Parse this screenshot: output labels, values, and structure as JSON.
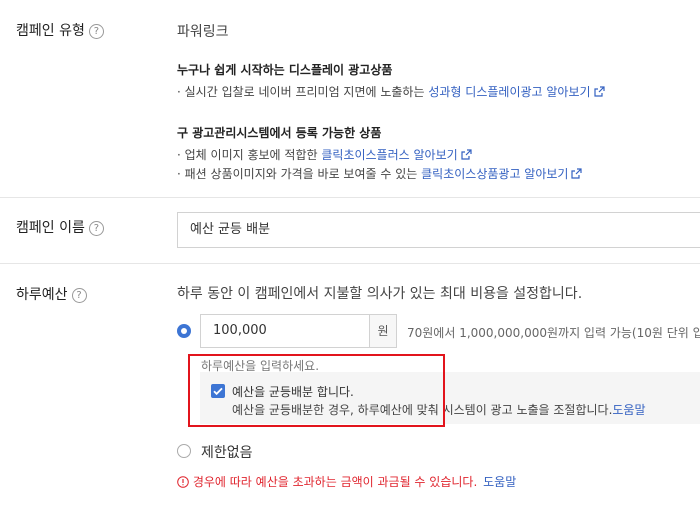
{
  "campaign_type": {
    "label": "캠페인 유형",
    "value": "파워링크",
    "section1_title": "누구나 쉽게 시작하는 디스플레이 광고상품",
    "section1_item_text": "실시간 입찰로 네이버 프리미엄 지면에 노출하는",
    "section1_item_link": "성과형 디스플레이광고 알아보기",
    "section2_title": "구 광고관리시스템에서 등록 가능한 상품",
    "section2_item1_text": "업체 이미지 홍보에 적합한",
    "section2_item1_link": "클릭초이스플러스 알아보기",
    "section2_item2_text": "패션 상품이미지와 가격을 바로 보여줄 수 있는",
    "section2_item2_link": "클릭초이스상품광고 알아보기"
  },
  "campaign_name": {
    "label": "캠페인 이름",
    "value": "예산 균등 배분"
  },
  "daily_budget": {
    "label": "하루예산",
    "description": "하루 동안 이 캠페인에서 지불할 의사가 있는 최대 비용을 설정합니다.",
    "amount": "100,000",
    "unit": "원",
    "range_hint": "70원에서 1,000,000,000원까지 입력 가능(10원 단위 입",
    "placeholder_hint": "하루예산을 입력하세요.",
    "even_label": "예산을 균등배분 합니다.",
    "even_desc": "예산을 균등배분한 경우, 하루예산에 맞춰 시스템이 광고 노출을 조절합니다.",
    "even_help": "도움말",
    "unlimited_label": "제한없음",
    "warning": "경우에 따라 예산을 초과하는 금액이 과금될 수 있습니다.",
    "warning_help": "도움말"
  },
  "colors": {
    "accent": "#3d75d4",
    "link": "#3461c1",
    "warning": "#e0262f",
    "highlight_box": "#e2141c"
  },
  "icons": [
    "help-icon",
    "external-link-icon",
    "check-icon",
    "warning-icon"
  ]
}
